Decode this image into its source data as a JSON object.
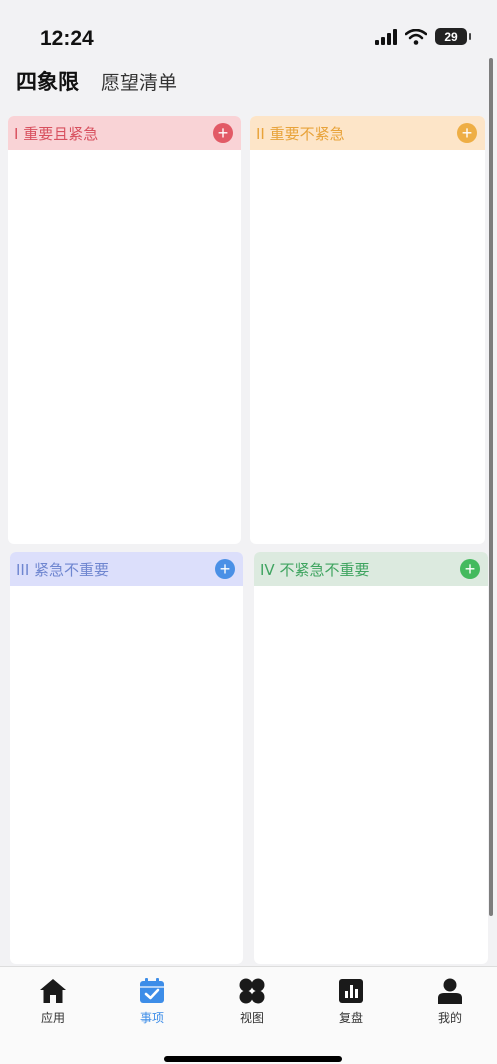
{
  "status": {
    "time": "12:24",
    "battery": "29"
  },
  "header": {
    "title": "四象限",
    "subtitle": "愿望清单"
  },
  "quadrants": [
    {
      "label": "I 重要且紧急",
      "color": "#e25a66"
    },
    {
      "label": "II 重要不紧急",
      "color": "#eeae45"
    },
    {
      "label": "III 紧急不重要",
      "color": "#4a90e6"
    },
    {
      "label": "IV 不紧急不重要",
      "color": "#44ba5e"
    }
  ],
  "tabbar": {
    "active_color": "#3d8de8",
    "items": [
      {
        "label": "应用",
        "icon": "home-icon"
      },
      {
        "label": "事项",
        "icon": "calendar-check-icon"
      },
      {
        "label": "视图",
        "icon": "four-petal-icon"
      },
      {
        "label": "复盘",
        "icon": "bar-chart-icon"
      },
      {
        "label": "我的",
        "icon": "person-icon"
      }
    ]
  }
}
